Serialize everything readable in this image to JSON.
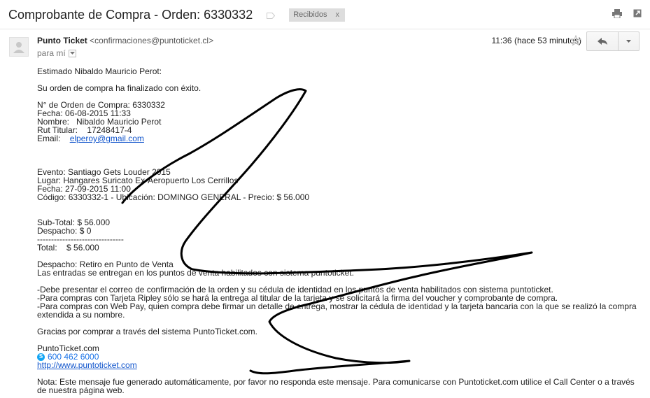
{
  "header": {
    "subject": "Comprobante de Compra - Orden: 6330332",
    "label": "Recibidos",
    "label_remove": "x",
    "print_icon": "printer-icon",
    "newwindow_icon": "open-new-window-icon"
  },
  "message": {
    "sender_name": "Punto Ticket",
    "sender_email": "<confirmaciones@puntoticket.cl>",
    "to": "para mí",
    "time": "11:36 (hace 53 minutos)"
  },
  "body": {
    "greeting": "Estimado Nibaldo Mauricio Perot:",
    "intro": "Su orden de compra ha finalizado con éxito.",
    "order_no": "N° de Orden de Compra: 6330332",
    "fecha": "Fecha: 06-08-2015 11:33",
    "nombre": "Nombre:   Nibaldo Mauricio Perot",
    "rut": "Rut Titular:    17248417-4",
    "email_label": "Email:    ",
    "email_value": "elperoy@gmail.com",
    "evento": "Evento: Santiago Gets Louder 2015",
    "lugar": "Lugar: Hangares Suricato Ex-Aeropuerto Los Cerrillos",
    "fecha_evento": "Fecha: 27-09-2015 11:00",
    "codigo": "Código: 6330332-1 - Ubicación: DOMINGO GENERAL - Precio: $ 56.000",
    "subtotal": "Sub-Total: $ 56.000",
    "despacho": "Despacho: $ 0",
    "separator": "-------------------------------",
    "total": "Total:    $ 56.000",
    "despacho_retiro": "Despacho: Retiro en Punto de Venta",
    "entradas": "Las entradas se entregan en los puntos de venta habilitados con sistema puntoticket.",
    "nota1": "-Debe presentar el correo de confirmación de la orden y su cédula de identidad en los puntos de venta habilitados con sistema puntoticket.",
    "nota2": "-Para compras con Tarjeta Ripley sólo se hará la entrega al titular de la tarjeta y se solicitará la firma del voucher y comprobante de compra.",
    "nota3": "-Para compras con Web Pay, quien compra debe firmar un detalle de entrega, mostrar la cédula de identidad y la tarjeta bancaria con la que se realizó la compra extendida a su nombre.",
    "gracias": "Gracias por comprar a través del sistema PuntoTicket.com.",
    "firma": "PuntoTicket.com",
    "telefono": "600 462 6000",
    "url": "http://www.puntoticket.com",
    "nota_final": "Nota: Este mensaje fue generado automáticamente, por favor no responda este mensaje. Para comunicarse con Puntoticket.com utilice el Call Center o a través de nuestra página web."
  }
}
